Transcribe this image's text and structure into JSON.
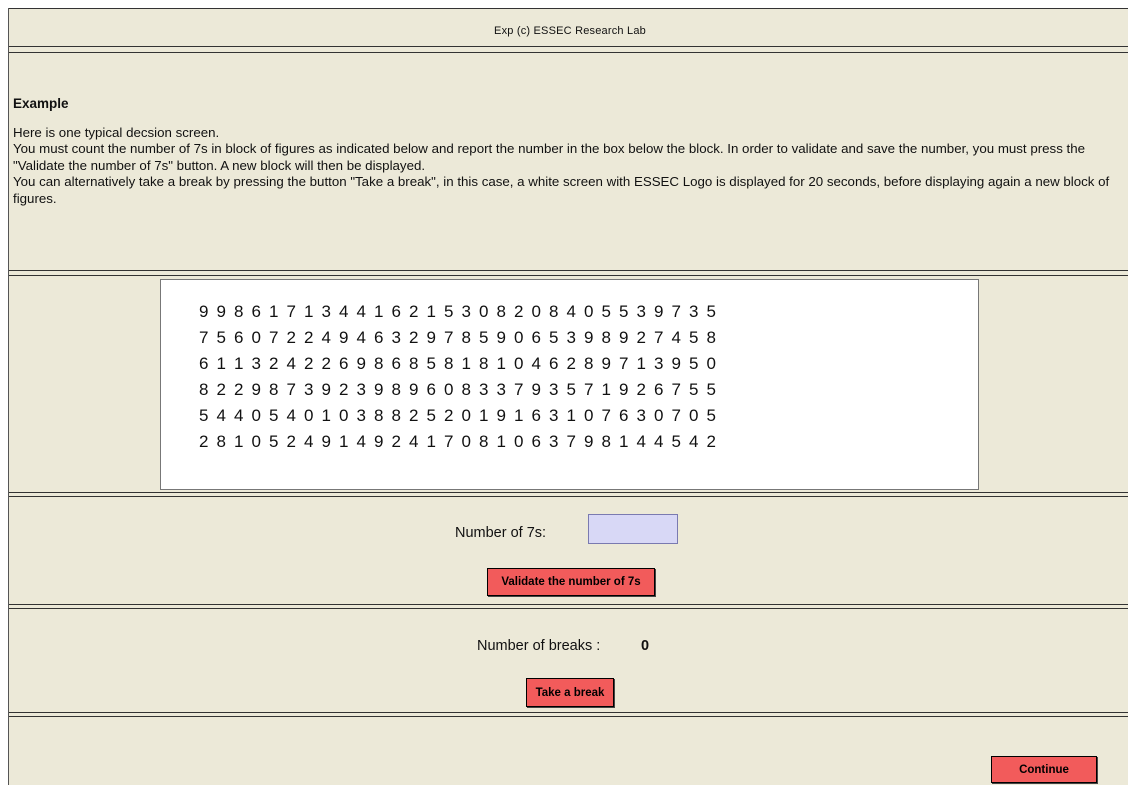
{
  "header": {
    "title": "Exp (c) ESSEC Research Lab"
  },
  "intro": {
    "heading": "Example",
    "lines": [
      "Here is one typical decsion screen.",
      "You must count the number of 7s in block of figures as indicated below and report the number in the box below the block. In order to validate and save the number, you must press the \"Validate the number of 7s\" button. A new block will then be displayed.",
      "You can alternatively take a break by pressing the button \"Take a break\", in this case, a white screen with ESSEC Logo is displayed for 20 seconds, before displaying again a new block of figures."
    ]
  },
  "digit_block": {
    "rows": [
      "998617134416215308208405539735",
      "756072249463297859065398927458",
      "611324226986858181046289713950",
      "822987392398960833793571926755",
      "544054010388252019163107630705",
      "281052491492417081063798144542"
    ]
  },
  "count_form": {
    "label": "Number of 7s:",
    "value": "",
    "validate_label": "Validate the number of 7s"
  },
  "breaks": {
    "label": "Number of breaks :",
    "count": "0",
    "take_break_label": "Take a break"
  },
  "footer": {
    "continue_label": "Continue"
  },
  "colors": {
    "panel_bg": "#ece9d8",
    "button_red": "#f25b5b",
    "input_bg": "#d8d8f6"
  }
}
